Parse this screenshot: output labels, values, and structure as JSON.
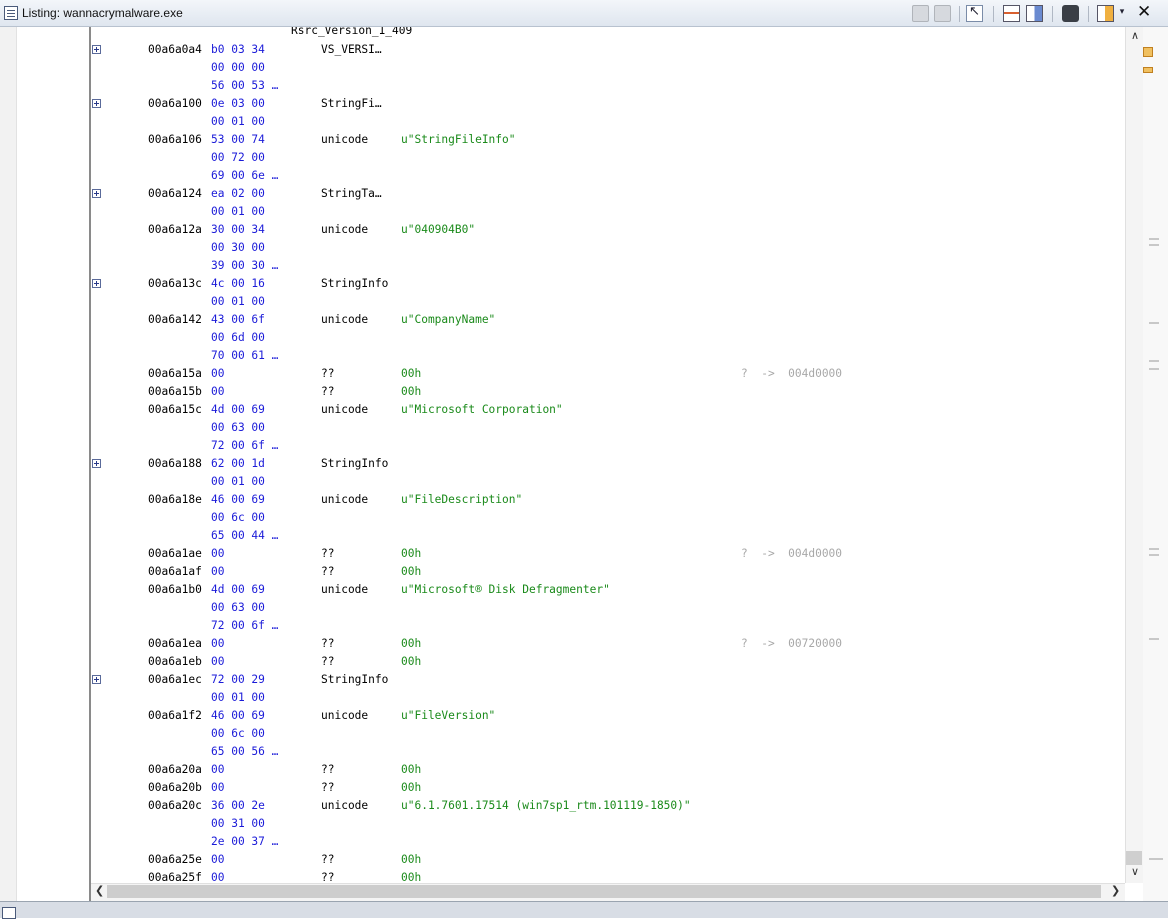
{
  "window": {
    "title": "Listing:  wannacrymalware.exe"
  },
  "listing": {
    "label": "Rsrc_Version_1_409",
    "rows": [
      {
        "expand": true,
        "addr": "00a6a0a4",
        "bytes": "b0 03 34",
        "mnem": "VS_VERSI…",
        "oper": "",
        "eol": ""
      },
      {
        "expand": false,
        "addr": "",
        "bytes": "00 00 00",
        "mnem": "",
        "oper": "",
        "eol": ""
      },
      {
        "expand": false,
        "addr": "",
        "bytes": "56 00 53 …",
        "mnem": "",
        "oper": "",
        "eol": ""
      },
      {
        "expand": true,
        "addr": "00a6a100",
        "bytes": "0e 03 00",
        "mnem": "StringFi…",
        "oper": "",
        "eol": ""
      },
      {
        "expand": false,
        "addr": "",
        "bytes": "00 01 00",
        "mnem": "",
        "oper": "",
        "eol": ""
      },
      {
        "expand": false,
        "addr": "00a6a106",
        "bytes": "53 00 74",
        "mnem": "unicode",
        "oper": "u\"StringFileInfo\"",
        "eol": ""
      },
      {
        "expand": false,
        "addr": "",
        "bytes": "00 72 00",
        "mnem": "",
        "oper": "",
        "eol": ""
      },
      {
        "expand": false,
        "addr": "",
        "bytes": "69 00 6e …",
        "mnem": "",
        "oper": "",
        "eol": ""
      },
      {
        "expand": true,
        "addr": "00a6a124",
        "bytes": "ea 02 00",
        "mnem": "StringTa…",
        "oper": "",
        "eol": ""
      },
      {
        "expand": false,
        "addr": "",
        "bytes": "00 01 00",
        "mnem": "",
        "oper": "",
        "eol": ""
      },
      {
        "expand": false,
        "addr": "00a6a12a",
        "bytes": "30 00 34",
        "mnem": "unicode",
        "oper": "u\"040904B0\"",
        "eol": ""
      },
      {
        "expand": false,
        "addr": "",
        "bytes": "00 30 00",
        "mnem": "",
        "oper": "",
        "eol": ""
      },
      {
        "expand": false,
        "addr": "",
        "bytes": "39 00 30 …",
        "mnem": "",
        "oper": "",
        "eol": ""
      },
      {
        "expand": true,
        "addr": "00a6a13c",
        "bytes": "4c 00 16",
        "mnem": "StringInfo",
        "oper": "",
        "eol": ""
      },
      {
        "expand": false,
        "addr": "",
        "bytes": "00 01 00",
        "mnem": "",
        "oper": "",
        "eol": ""
      },
      {
        "expand": false,
        "addr": "00a6a142",
        "bytes": "43 00 6f",
        "mnem": "unicode",
        "oper": "u\"CompanyName\"",
        "eol": ""
      },
      {
        "expand": false,
        "addr": "",
        "bytes": "00 6d 00",
        "mnem": "",
        "oper": "",
        "eol": ""
      },
      {
        "expand": false,
        "addr": "",
        "bytes": "70 00 61 …",
        "mnem": "",
        "oper": "",
        "eol": ""
      },
      {
        "expand": false,
        "addr": "00a6a15a",
        "bytes": "00",
        "mnem": "??",
        "oper": "00h",
        "eol": "?  ->  004d0000"
      },
      {
        "expand": false,
        "addr": "00a6a15b",
        "bytes": "00",
        "mnem": "??",
        "oper": "00h",
        "eol": ""
      },
      {
        "expand": false,
        "addr": "00a6a15c",
        "bytes": "4d 00 69",
        "mnem": "unicode",
        "oper": "u\"Microsoft Corporation\"",
        "eol": ""
      },
      {
        "expand": false,
        "addr": "",
        "bytes": "00 63 00",
        "mnem": "",
        "oper": "",
        "eol": ""
      },
      {
        "expand": false,
        "addr": "",
        "bytes": "72 00 6f …",
        "mnem": "",
        "oper": "",
        "eol": ""
      },
      {
        "expand": true,
        "addr": "00a6a188",
        "bytes": "62 00 1d",
        "mnem": "StringInfo",
        "oper": "",
        "eol": ""
      },
      {
        "expand": false,
        "addr": "",
        "bytes": "00 01 00",
        "mnem": "",
        "oper": "",
        "eol": ""
      },
      {
        "expand": false,
        "addr": "00a6a18e",
        "bytes": "46 00 69",
        "mnem": "unicode",
        "oper": "u\"FileDescription\"",
        "eol": ""
      },
      {
        "expand": false,
        "addr": "",
        "bytes": "00 6c 00",
        "mnem": "",
        "oper": "",
        "eol": ""
      },
      {
        "expand": false,
        "addr": "",
        "bytes": "65 00 44 …",
        "mnem": "",
        "oper": "",
        "eol": ""
      },
      {
        "expand": false,
        "addr": "00a6a1ae",
        "bytes": "00",
        "mnem": "??",
        "oper": "00h",
        "eol": "?  ->  004d0000"
      },
      {
        "expand": false,
        "addr": "00a6a1af",
        "bytes": "00",
        "mnem": "??",
        "oper": "00h",
        "eol": ""
      },
      {
        "expand": false,
        "addr": "00a6a1b0",
        "bytes": "4d 00 69",
        "mnem": "unicode",
        "oper": "u\"Microsoft® Disk Defragmenter\"",
        "eol": ""
      },
      {
        "expand": false,
        "addr": "",
        "bytes": "00 63 00",
        "mnem": "",
        "oper": "",
        "eol": ""
      },
      {
        "expand": false,
        "addr": "",
        "bytes": "72 00 6f …",
        "mnem": "",
        "oper": "",
        "eol": ""
      },
      {
        "expand": false,
        "addr": "00a6a1ea",
        "bytes": "00",
        "mnem": "??",
        "oper": "00h",
        "eol": "?  ->  00720000"
      },
      {
        "expand": false,
        "addr": "00a6a1eb",
        "bytes": "00",
        "mnem": "??",
        "oper": "00h",
        "eol": ""
      },
      {
        "expand": true,
        "addr": "00a6a1ec",
        "bytes": "72 00 29",
        "mnem": "StringInfo",
        "oper": "",
        "eol": ""
      },
      {
        "expand": false,
        "addr": "",
        "bytes": "00 01 00",
        "mnem": "",
        "oper": "",
        "eol": ""
      },
      {
        "expand": false,
        "addr": "00a6a1f2",
        "bytes": "46 00 69",
        "mnem": "unicode",
        "oper": "u\"FileVersion\"",
        "eol": ""
      },
      {
        "expand": false,
        "addr": "",
        "bytes": "00 6c 00",
        "mnem": "",
        "oper": "",
        "eol": ""
      },
      {
        "expand": false,
        "addr": "",
        "bytes": "65 00 56 …",
        "mnem": "",
        "oper": "",
        "eol": ""
      },
      {
        "expand": false,
        "addr": "00a6a20a",
        "bytes": "00",
        "mnem": "??",
        "oper": "00h",
        "eol": ""
      },
      {
        "expand": false,
        "addr": "00a6a20b",
        "bytes": "00",
        "mnem": "??",
        "oper": "00h",
        "eol": ""
      },
      {
        "expand": false,
        "addr": "00a6a20c",
        "bytes": "36 00 2e",
        "mnem": "unicode",
        "oper": "u\"6.1.7601.17514 (win7sp1_rtm.101119-1850)\"",
        "eol": ""
      },
      {
        "expand": false,
        "addr": "",
        "bytes": "00 31 00",
        "mnem": "",
        "oper": "",
        "eol": ""
      },
      {
        "expand": false,
        "addr": "",
        "bytes": "2e 00 37 …",
        "mnem": "",
        "oper": "",
        "eol": ""
      },
      {
        "expand": false,
        "addr": "00a6a25e",
        "bytes": "00",
        "mnem": "??",
        "oper": "00h",
        "eol": ""
      },
      {
        "expand": false,
        "addr": "00a6a25f",
        "bytes": "00",
        "mnem": "??",
        "oper": "00h",
        "eol": ""
      }
    ]
  },
  "toolbar": {
    "icons": [
      "copy-icon",
      "paste-icon",
      "cursor-icon",
      "field-layout-icon",
      "diff-icon",
      "snapshot-icon",
      "column-icon",
      "dropdown-icon",
      "close-icon"
    ]
  },
  "colors": {
    "address": "#000000",
    "bytes": "#1a1ad8",
    "operand": "#1a8a1a",
    "eol_comment": "#a8a8a8"
  }
}
